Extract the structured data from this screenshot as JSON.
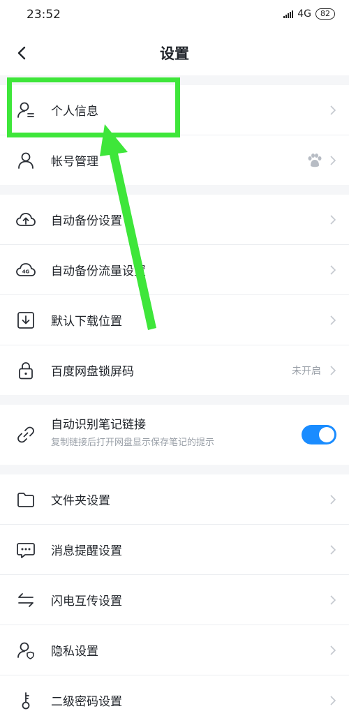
{
  "status": {
    "time": "23:52",
    "network": "4G",
    "battery": "82"
  },
  "nav": {
    "title": "设置"
  },
  "groups": {
    "account": [
      {
        "label": "个人信息"
      },
      {
        "label": "帐号管理"
      }
    ],
    "backup": [
      {
        "label": "自动备份设置"
      },
      {
        "label": "自动备份流量设置"
      },
      {
        "label": "默认下载位置"
      },
      {
        "label": "百度网盘锁屏码",
        "value": "未开启"
      }
    ],
    "notes": {
      "label": "自动识别笔记链接",
      "sub": "复制链接后打开网盘显示保存笔记的提示",
      "toggle_on": true
    },
    "more": [
      {
        "label": "文件夹设置"
      },
      {
        "label": "消息提醒设置"
      },
      {
        "label": "闪电互传设置"
      },
      {
        "label": "隐私设置"
      },
      {
        "label": "二级密码设置"
      }
    ]
  },
  "colors": {
    "accent": "#1a8cff",
    "highlight": "#3ee63a"
  }
}
